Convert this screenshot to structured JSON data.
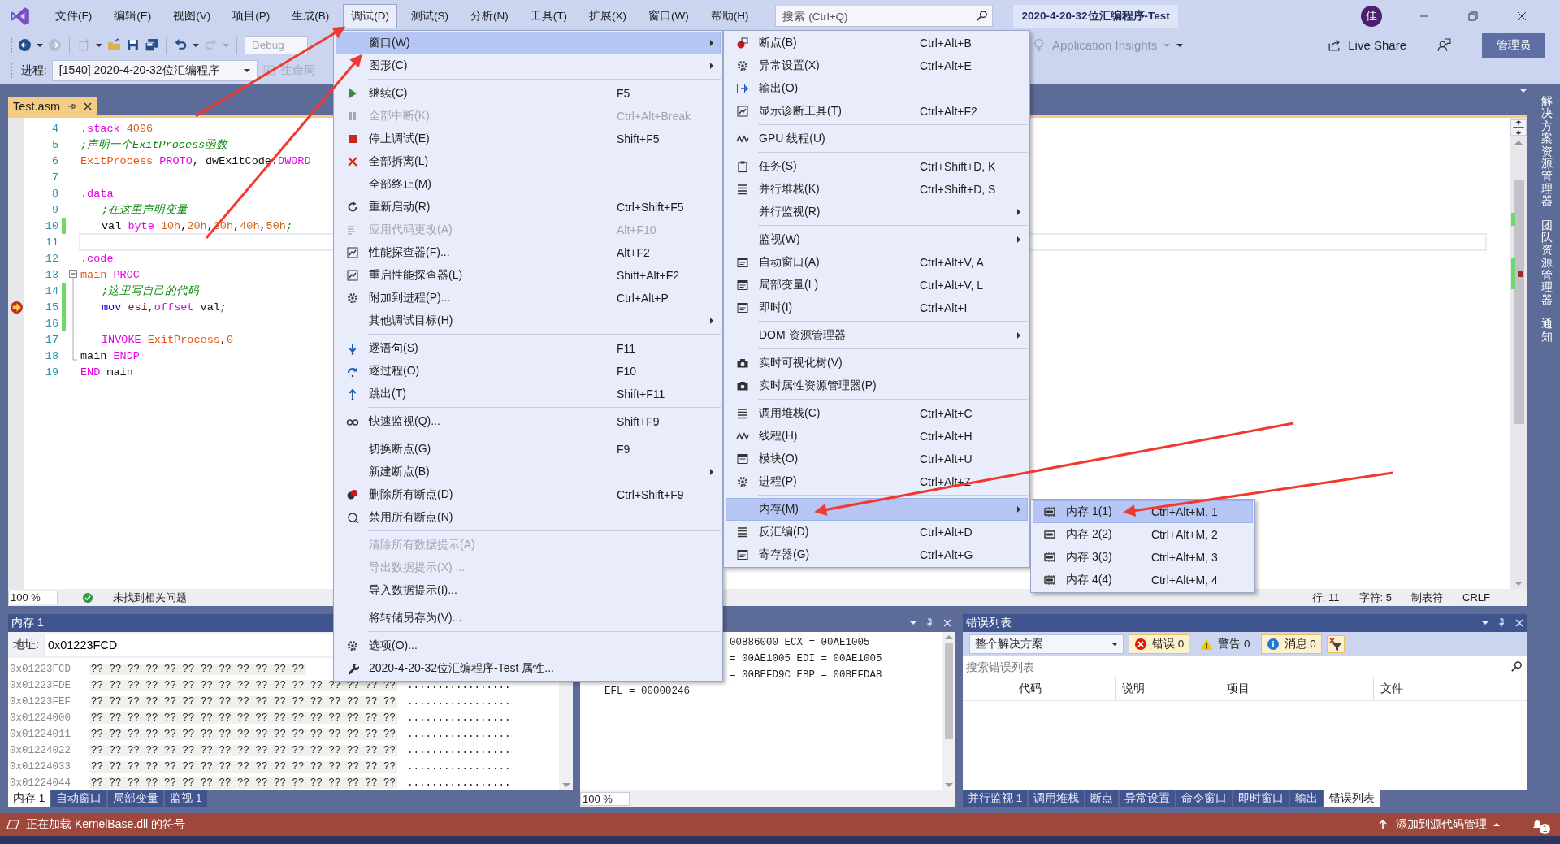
{
  "window": {
    "title": "2020-4-20-32位汇编程序-Test",
    "search_placeholder": "搜索 (Ctrl+Q)",
    "account_initial": "佳"
  },
  "menu_bar": [
    {
      "label": "文件(F)",
      "selected": false
    },
    {
      "label": "编辑(E)",
      "selected": false
    },
    {
      "label": "视图(V)",
      "selected": false
    },
    {
      "label": "项目(P)",
      "selected": false
    },
    {
      "label": "生成(B)",
      "selected": false
    },
    {
      "label": "调试(D)",
      "selected": true
    },
    {
      "label": "测试(S)",
      "selected": false
    },
    {
      "label": "分析(N)",
      "selected": false
    },
    {
      "label": "工具(T)",
      "selected": false
    },
    {
      "label": "扩展(X)",
      "selected": false
    },
    {
      "label": "窗口(W)",
      "selected": false
    },
    {
      "label": "帮助(H)",
      "selected": false
    }
  ],
  "toolbar": {
    "configuration": "Debug",
    "process_label": "进程:",
    "process": "[1540] 2020-4-20-32位汇编程序",
    "lifecycle": "生命周",
    "application_insights": "Application Insights",
    "live_share": "Live Share",
    "admin_button": "管理员"
  },
  "editor": {
    "tab": "Test.asm",
    "zoom": "100 %",
    "issues": "未找到相关问题",
    "line": "行: 11",
    "char": "字符: 5",
    "tabs_mode": "制表符",
    "line_ending": "CRLF",
    "lines": [
      {
        "number": "4",
        "indent": false,
        "changed": false,
        "current": false,
        "cursor": false,
        "tokens": [
          {
            "text": ".stack",
            "kind": "directive"
          },
          {
            "text": " 4096",
            "kind": "number"
          }
        ]
      },
      {
        "number": "5",
        "indent": false,
        "changed": false,
        "current": false,
        "cursor": false,
        "tokens": [
          {
            "text": ";声明一个ExitProcess函数",
            "kind": "comment"
          }
        ]
      },
      {
        "number": "6",
        "indent": false,
        "changed": false,
        "current": false,
        "cursor": false,
        "tokens": [
          {
            "text": "ExitProcess",
            "kind": "name"
          },
          {
            "text": " PROTO",
            "kind": "directive"
          },
          {
            "text": ", dwExitCode:",
            "kind": "plain"
          },
          {
            "text": "DWORD",
            "kind": "directive"
          }
        ]
      },
      {
        "number": "7",
        "changed": false,
        "current": false,
        "cursor": false
      },
      {
        "number": "8",
        "indent": false,
        "changed": false,
        "current": false,
        "cursor": false,
        "tokens": [
          {
            "text": ".data",
            "kind": "directive"
          }
        ]
      },
      {
        "number": "9",
        "indent": true,
        "changed": false,
        "current": false,
        "cursor": false,
        "tokens": [
          {
            "text": ";在这里声明变量",
            "kind": "comment"
          }
        ]
      },
      {
        "number": "10",
        "indent": true,
        "changed": true,
        "current": false,
        "cursor": false,
        "tokens": [
          {
            "text": "val ",
            "kind": "plain"
          },
          {
            "text": "byte ",
            "kind": "directive"
          },
          {
            "text": "10h",
            "kind": "number"
          },
          {
            "text": ",",
            "kind": "plain"
          },
          {
            "text": "20h",
            "kind": "number"
          },
          {
            "text": ",",
            "kind": "plain"
          },
          {
            "text": "30h",
            "kind": "number"
          },
          {
            "text": ",",
            "kind": "plain"
          },
          {
            "text": "40h",
            "kind": "number"
          },
          {
            "text": ",",
            "kind": "plain"
          },
          {
            "text": "50h",
            "kind": "number"
          },
          {
            "text": ";",
            "kind": "comment"
          }
        ]
      },
      {
        "number": "11",
        "changed": false,
        "current": false,
        "cursor": true
      },
      {
        "number": "12",
        "indent": false,
        "changed": false,
        "current": false,
        "cursor": false,
        "tokens": [
          {
            "text": ".code",
            "kind": "directive"
          }
        ]
      },
      {
        "number": "13",
        "indent": false,
        "changed": false,
        "current": false,
        "cursor": false,
        "fold": {
          "kind": "start"
        },
        "tokens": [
          {
            "text": "main",
            "kind": "name"
          },
          {
            "text": " PROC",
            "kind": "directive"
          }
        ]
      },
      {
        "number": "14",
        "indent": true,
        "changed": true,
        "current": false,
        "cursor": false,
        "fold": {
          "kind": "inside"
        },
        "tokens": [
          {
            "text": ";这里写自己的代码",
            "kind": "comment"
          }
        ]
      },
      {
        "number": "15",
        "indent": true,
        "changed": true,
        "current": true,
        "cursor": false,
        "fold": {
          "kind": "inside"
        },
        "tokens": [
          {
            "text": "mov ",
            "kind": "instruction"
          },
          {
            "text": "esi",
            "kind": "register"
          },
          {
            "text": ",",
            "kind": "plain"
          },
          {
            "text": "offset ",
            "kind": "directive"
          },
          {
            "text": "val",
            "kind": "plain"
          },
          {
            "text": ";",
            "kind": "comment"
          }
        ]
      },
      {
        "number": "16",
        "changed": true,
        "current": false,
        "cursor": false,
        "fold": {
          "kind": "inside"
        }
      },
      {
        "number": "17",
        "indent": true,
        "changed": false,
        "current": false,
        "cursor": false,
        "fold": {
          "kind": "inside"
        },
        "tokens": [
          {
            "text": "INVOKE ",
            "kind": "directive"
          },
          {
            "text": "ExitProcess",
            "kind": "name"
          },
          {
            "text": ",",
            "kind": "plain"
          },
          {
            "text": "0",
            "kind": "number"
          }
        ]
      },
      {
        "number": "18",
        "indent": false,
        "changed": false,
        "current": false,
        "cursor": false,
        "fold": {
          "kind": "end"
        },
        "tokens": [
          {
            "text": "main ",
            "kind": "plain"
          },
          {
            "text": "ENDP",
            "kind": "directive"
          }
        ]
      },
      {
        "number": "19",
        "indent": false,
        "changed": false,
        "current": false,
        "cursor": false,
        "tokens": [
          {
            "text": "END",
            "kind": "directive"
          },
          {
            "text": " main",
            "kind": "plain"
          }
        ]
      }
    ]
  },
  "debug_menu": [
    {
      "kind": "item",
      "label": "窗口(W)",
      "submenu": true,
      "disabled": false,
      "selected": true
    },
    {
      "kind": "item",
      "label": "图形(C)",
      "submenu": true,
      "disabled": false,
      "selected": false
    },
    {
      "kind": "separator"
    },
    {
      "kind": "item",
      "label": "继续(C)",
      "shortcut": "F5",
      "submenu": false,
      "disabled": false,
      "selected": false
    },
    {
      "kind": "item",
      "label": "全部中断(K)",
      "shortcut": "Ctrl+Alt+Break",
      "submenu": false,
      "disabled": true,
      "selected": false
    },
    {
      "kind": "item",
      "label": "停止调试(E)",
      "shortcut": "Shift+F5",
      "submenu": false,
      "disabled": false,
      "selected": false
    },
    {
      "kind": "item",
      "label": "全部拆离(L)",
      "submenu": false,
      "disabled": false,
      "selected": false
    },
    {
      "kind": "item",
      "label": "全部终止(M)",
      "submenu": false,
      "disabled": false,
      "selected": false
    },
    {
      "kind": "item",
      "label": "重新启动(R)",
      "shortcut": "Ctrl+Shift+F5",
      "submenu": false,
      "disabled": false,
      "selected": false
    },
    {
      "kind": "item",
      "label": "应用代码更改(A)",
      "shortcut": "Alt+F10",
      "submenu": false,
      "disabled": true,
      "selected": false
    },
    {
      "kind": "item",
      "label": "性能探查器(F)...",
      "shortcut": "Alt+F2",
      "submenu": false,
      "disabled": false,
      "selected": false
    },
    {
      "kind": "item",
      "label": "重启性能探查器(L)",
      "shortcut": "Shift+Alt+F2",
      "submenu": false,
      "disabled": false,
      "selected": false
    },
    {
      "kind": "item",
      "label": "附加到进程(P)...",
      "shortcut": "Ctrl+Alt+P",
      "submenu": false,
      "disabled": false,
      "selected": false
    },
    {
      "kind": "item",
      "label": "其他调试目标(H)",
      "submenu": true,
      "disabled": false,
      "selected": false
    },
    {
      "kind": "separator"
    },
    {
      "kind": "item",
      "label": "逐语句(S)",
      "shortcut": "F11",
      "submenu": false,
      "disabled": false,
      "selected": false
    },
    {
      "kind": "item",
      "label": "逐过程(O)",
      "shortcut": "F10",
      "submenu": false,
      "disabled": false,
      "selected": false
    },
    {
      "kind": "item",
      "label": "跳出(T)",
      "shortcut": "Shift+F11",
      "submenu": false,
      "disabled": false,
      "selected": false
    },
    {
      "kind": "separator"
    },
    {
      "kind": "item",
      "label": "快速监视(Q)...",
      "shortcut": "Shift+F9",
      "submenu": false,
      "disabled": false,
      "selected": false
    },
    {
      "kind": "separator"
    },
    {
      "kind": "item",
      "label": "切换断点(G)",
      "shortcut": "F9",
      "submenu": false,
      "disabled": false,
      "selected": false
    },
    {
      "kind": "item",
      "label": "新建断点(B)",
      "submenu": true,
      "disabled": false,
      "selected": false
    },
    {
      "kind": "item",
      "label": "删除所有断点(D)",
      "shortcut": "Ctrl+Shift+F9",
      "submenu": false,
      "disabled": false,
      "selected": false
    },
    {
      "kind": "item",
      "label": "禁用所有断点(N)",
      "submenu": false,
      "disabled": false,
      "selected": false
    },
    {
      "kind": "separator"
    },
    {
      "kind": "item",
      "label": "清除所有数据提示(A)",
      "submenu": false,
      "disabled": true,
      "selected": false
    },
    {
      "kind": "item",
      "label": "导出数据提示(X) ...",
      "submenu": false,
      "disabled": true,
      "selected": false
    },
    {
      "kind": "item",
      "label": "导入数据提示(I)...",
      "submenu": false,
      "disabled": false,
      "selected": false
    },
    {
      "kind": "separator"
    },
    {
      "kind": "item",
      "label": "将转储另存为(V)...",
      "submenu": false,
      "disabled": false,
      "selected": false
    },
    {
      "kind": "separator"
    },
    {
      "kind": "item",
      "label": "选项(O)...",
      "submenu": false,
      "disabled": false,
      "selected": false
    },
    {
      "kind": "item",
      "label": "2020-4-20-32位汇编程序-Test 属性...",
      "submenu": false,
      "disabled": false,
      "selected": false
    }
  ],
  "window_submenu": [
    {
      "kind": "item",
      "label": "断点(B)",
      "shortcut": "Ctrl+Alt+B",
      "submenu": false,
      "selected": false
    },
    {
      "kind": "item",
      "label": "异常设置(X)",
      "shortcut": "Ctrl+Alt+E",
      "submenu": false,
      "selected": false
    },
    {
      "kind": "item",
      "label": "输出(O)",
      "submenu": false,
      "selected": false
    },
    {
      "kind": "item",
      "label": "显示诊断工具(T)",
      "shortcut": "Ctrl+Alt+F2",
      "submenu": false,
      "selected": false
    },
    {
      "kind": "separator"
    },
    {
      "kind": "item",
      "label": "GPU 线程(U)",
      "submenu": false,
      "selected": false
    },
    {
      "kind": "separator"
    },
    {
      "kind": "item",
      "label": "任务(S)",
      "shortcut": "Ctrl+Shift+D, K",
      "submenu": false,
      "selected": false
    },
    {
      "kind": "item",
      "label": "并行堆栈(K)",
      "shortcut": "Ctrl+Shift+D, S",
      "submenu": false,
      "selected": false
    },
    {
      "kind": "item",
      "label": "并行监视(R)",
      "submenu": true,
      "selected": false
    },
    {
      "kind": "separator"
    },
    {
      "kind": "item",
      "label": "监视(W)",
      "submenu": true,
      "selected": false
    },
    {
      "kind": "item",
      "label": "自动窗口(A)",
      "shortcut": "Ctrl+Alt+V, A",
      "submenu": false,
      "selected": false
    },
    {
      "kind": "item",
      "label": "局部变量(L)",
      "shortcut": "Ctrl+Alt+V, L",
      "submenu": false,
      "selected": false
    },
    {
      "kind": "item",
      "label": "即时(I)",
      "shortcut": "Ctrl+Alt+I",
      "submenu": false,
      "selected": false
    },
    {
      "kind": "separator"
    },
    {
      "kind": "item",
      "label": "DOM 资源管理器",
      "submenu": true,
      "selected": false
    },
    {
      "kind": "separator"
    },
    {
      "kind": "item",
      "label": "实时可视化树(V)",
      "submenu": false,
      "selected": false
    },
    {
      "kind": "item",
      "label": "实时属性资源管理器(P)",
      "submenu": false,
      "selected": false
    },
    {
      "kind": "separator"
    },
    {
      "kind": "item",
      "label": "调用堆栈(C)",
      "shortcut": "Ctrl+Alt+C",
      "submenu": false,
      "selected": false
    },
    {
      "kind": "item",
      "label": "线程(H)",
      "shortcut": "Ctrl+Alt+H",
      "submenu": false,
      "selected": false
    },
    {
      "kind": "item",
      "label": "模块(O)",
      "shortcut": "Ctrl+Alt+U",
      "submenu": false,
      "selected": false
    },
    {
      "kind": "item",
      "label": "进程(P)",
      "shortcut": "Ctrl+Alt+Z",
      "submenu": false,
      "selected": false
    },
    {
      "kind": "separator"
    },
    {
      "kind": "item",
      "label": "内存(M)",
      "submenu": true,
      "selected": true
    },
    {
      "kind": "item",
      "label": "反汇编(D)",
      "shortcut": "Ctrl+Alt+D",
      "submenu": false,
      "selected": false
    },
    {
      "kind": "item",
      "label": "寄存器(G)",
      "shortcut": "Ctrl+Alt+G",
      "submenu": false,
      "selected": false
    }
  ],
  "memory_submenu": [
    {
      "kind": "item",
      "label": "内存 1(1)",
      "shortcut": "Ctrl+Alt+M, 1",
      "selected": true
    },
    {
      "kind": "item",
      "label": "内存 2(2)",
      "shortcut": "Ctrl+Alt+M, 2",
      "selected": false
    },
    {
      "kind": "item",
      "label": "内存 3(3)",
      "shortcut": "Ctrl+Alt+M, 3",
      "selected": false
    },
    {
      "kind": "item",
      "label": "内存 4(4)",
      "shortcut": "Ctrl+Alt+M, 4",
      "selected": false
    }
  ],
  "memory_panel": {
    "title": "内存 1",
    "address_label": "地址:",
    "address": "0x01223FCD",
    "rows": [
      {
        "address": "0x01223FCD",
        "bytes": "?? ?? ?? ?? ?? ?? ?? ?? ?? ?? ?? ??"
      },
      {
        "address": "0x01223FDE",
        "bytes": "?? ?? ?? ?? ?? ?? ?? ?? ?? ?? ?? ?? ?? ?? ?? ?? ??",
        "ascii": "................."
      },
      {
        "address": "0x01223FEF",
        "bytes": "?? ?? ?? ?? ?? ?? ?? ?? ?? ?? ?? ?? ?? ?? ?? ?? ??",
        "ascii": "................."
      },
      {
        "address": "0x01224000",
        "bytes": "?? ?? ?? ?? ?? ?? ?? ?? ?? ?? ?? ?? ?? ?? ?? ?? ??",
        "ascii": "................."
      },
      {
        "address": "0x01224011",
        "bytes": "?? ?? ?? ?? ?? ?? ?? ?? ?? ?? ?? ?? ?? ?? ?? ?? ??",
        "ascii": "................."
      },
      {
        "address": "0x01224022",
        "bytes": "?? ?? ?? ?? ?? ?? ?? ?? ?? ?? ?? ?? ?? ?? ?? ?? ??",
        "ascii": "................."
      },
      {
        "address": "0x01224033",
        "bytes": "?? ?? ?? ?? ?? ?? ?? ?? ?? ?? ?? ?? ?? ?? ?? ?? ??",
        "ascii": "................."
      },
      {
        "address": "0x01224044",
        "bytes": "?? ?? ?? ?? ?? ?? ?? ?? ?? ?? ?? ?? ?? ?? ?? ?? ??",
        "ascii": "................."
      }
    ],
    "tabs": [
      {
        "label": "内存 1",
        "selected": true
      },
      {
        "label": "自动窗口",
        "selected": false
      },
      {
        "label": "局部变量",
        "selected": false
      },
      {
        "label": "监视 1",
        "selected": false
      }
    ]
  },
  "registers_panel": {
    "zoom": "100 %",
    "lines": [
      {
        "kind": "cut",
        "text": "00886000 ECX = 00AE1005"
      },
      {
        "kind": "cut",
        "text": "= 00AE1005 EDI = 00AE1005"
      },
      {
        "kind": "cut",
        "text": "= 00BEFD9C EBP = 00BEFDA8"
      },
      {
        "kind": "full",
        "text": "EFL = 00000246"
      }
    ]
  },
  "error_list": {
    "title": "错误列表",
    "scope": "整个解决方案",
    "search_placeholder": "搜索错误列表",
    "filters": [
      {
        "kind": "error",
        "label": "错误 0",
        "selected": true
      },
      {
        "kind": "warning",
        "label": "警告 0",
        "selected": false
      },
      {
        "kind": "info",
        "label": "消息 0",
        "selected": true
      }
    ],
    "columns": [
      "代码",
      "说明",
      "项目",
      "文件"
    ],
    "tabs": [
      {
        "label": "并行监视 1",
        "selected": false
      },
      {
        "label": "调用堆栈",
        "selected": false
      },
      {
        "label": "断点",
        "selected": false
      },
      {
        "label": "异常设置",
        "selected": false
      },
      {
        "label": "命令窗口",
        "selected": false
      },
      {
        "label": "即时窗口",
        "selected": false
      },
      {
        "label": "输出",
        "selected": false
      },
      {
        "label": "错误列表",
        "selected": true
      }
    ]
  },
  "side_tabs": [
    "解决方案资源管理器",
    "团队资源管理器",
    "通知"
  ],
  "status_bar": {
    "message": "正在加载 KernelBase.dll 的符号",
    "source_control": "添加到源代码管理",
    "notifications": "1"
  }
}
